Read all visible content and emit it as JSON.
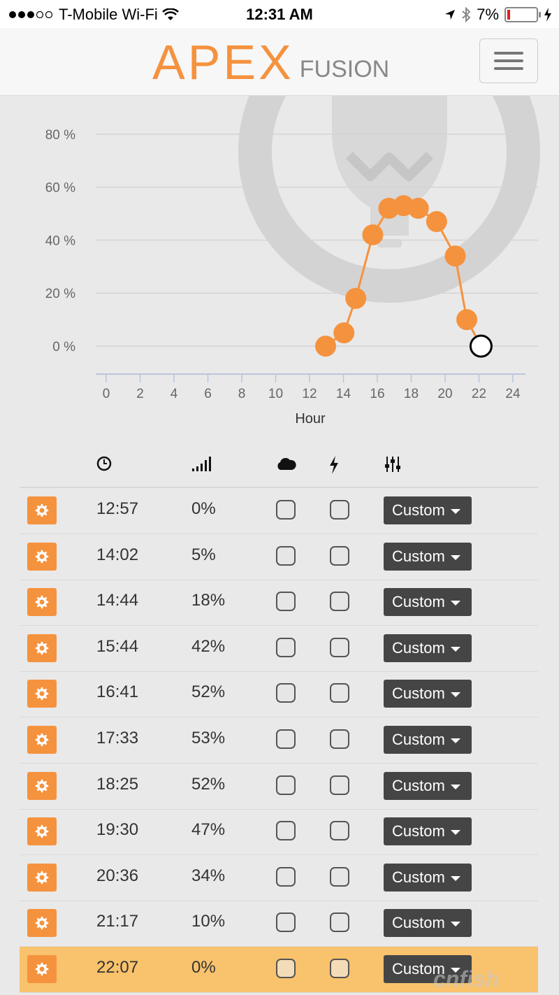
{
  "status_bar": {
    "carrier": "T-Mobile Wi-Fi",
    "time": "12:31 AM",
    "battery": "7%"
  },
  "header": {
    "logo_main": "APEX",
    "logo_sub": "FUSION",
    "menu_icon": "hamburger-icon"
  },
  "chart_data": {
    "type": "line",
    "xlabel": "Hour",
    "ylabel": "",
    "xlim": [
      0,
      24
    ],
    "ylim": [
      0,
      80
    ],
    "x_ticks": [
      "0",
      "2",
      "4",
      "6",
      "8",
      "10",
      "12",
      "14",
      "16",
      "18",
      "20",
      "22",
      "24"
    ],
    "y_ticks": [
      "0 %",
      "20 %",
      "40 %",
      "60 %",
      "80 %"
    ],
    "grid": true,
    "background_icon": "lightbulb-icon",
    "color": "#f5923e",
    "series": [
      {
        "points": [
          {
            "x": 12.95,
            "y": 0
          },
          {
            "x": 14.03,
            "y": 5
          },
          {
            "x": 14.73,
            "y": 18
          },
          {
            "x": 15.73,
            "y": 42
          },
          {
            "x": 16.68,
            "y": 52
          },
          {
            "x": 17.55,
            "y": 53
          },
          {
            "x": 18.42,
            "y": 52
          },
          {
            "x": 19.5,
            "y": 47
          },
          {
            "x": 20.6,
            "y": 34
          },
          {
            "x": 21.28,
            "y": 10
          },
          {
            "x": 22.12,
            "y": 0
          }
        ]
      }
    ],
    "selected_point_index": 10
  },
  "table": {
    "header_icons": [
      "clock-icon",
      "signal-icon",
      "cloud-icon",
      "lightning-icon",
      "sliders-icon"
    ],
    "rows": [
      {
        "time": "12:57",
        "intensity": "0%",
        "mode": "Custom"
      },
      {
        "time": "14:02",
        "intensity": "5%",
        "mode": "Custom"
      },
      {
        "time": "14:44",
        "intensity": "18%",
        "mode": "Custom"
      },
      {
        "time": "15:44",
        "intensity": "42%",
        "mode": "Custom"
      },
      {
        "time": "16:41",
        "intensity": "52%",
        "mode": "Custom"
      },
      {
        "time": "17:33",
        "intensity": "53%",
        "mode": "Custom"
      },
      {
        "time": "18:25",
        "intensity": "52%",
        "mode": "Custom"
      },
      {
        "time": "19:30",
        "intensity": "47%",
        "mode": "Custom"
      },
      {
        "time": "20:36",
        "intensity": "34%",
        "mode": "Custom"
      },
      {
        "time": "21:17",
        "intensity": "10%",
        "mode": "Custom"
      },
      {
        "time": "22:07",
        "intensity": "0%",
        "mode": "Custom",
        "selected": true
      }
    ]
  },
  "colors": {
    "accent": "#f5923e",
    "selected_row": "#f9c26c",
    "dropdown": "#454545"
  }
}
